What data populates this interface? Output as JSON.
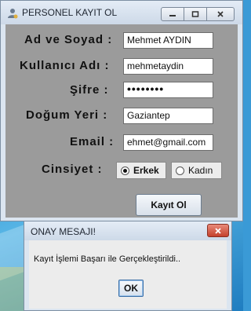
{
  "window": {
    "title": "PERSONEL KAYIT OL"
  },
  "form": {
    "name_label": "Ad ve Soyad :",
    "name_value": "Mehmet AYDIN",
    "username_label": "Kullanıcı Adı :",
    "username_value": "mehmetaydin",
    "password_label": "Şifre :",
    "password_value": "••••••••",
    "birthplace_label": "Doğum Yeri :",
    "birthplace_value": "Gaziantep",
    "email_label": "Email :",
    "email_value": "ehmet@gmail.com",
    "gender_label": "Cinsiyet :",
    "gender_options": [
      {
        "label": "Erkek",
        "selected": true
      },
      {
        "label": "Kadın",
        "selected": false
      }
    ],
    "submit_label": "Kayıt Ol"
  },
  "dialog": {
    "title": "ONAY MESAJI!",
    "message": "Kayıt İşlemi Başarı ile Gerçekleştirildi..",
    "ok_label": "OK"
  },
  "colors": {
    "form_background": "#9b9b9b",
    "window_frame": "#dbe5f0",
    "close_button": "#c4412c",
    "desktop": "#3a9ad6"
  }
}
